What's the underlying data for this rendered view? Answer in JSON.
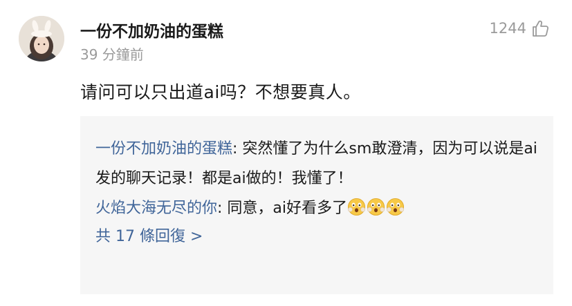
{
  "comment": {
    "username": "一份不加奶油的蛋糕",
    "time": "39 分鐘前",
    "likes": "1244",
    "text": "请问可以只出道ai吗？不想要真人。"
  },
  "replies": [
    {
      "user": "一份不加奶油的蛋糕",
      "separator": ": ",
      "text": "突然懂了为什么sm敢澄清，因为可以说是ai发的聊天记录！都是ai做的！我懂了！"
    },
    {
      "user": "火焰大海无尽的你",
      "separator": ": ",
      "text": "同意，ai好看多了",
      "emojis": [
        "astonished-face",
        "astonished-face",
        "astonished-face"
      ]
    }
  ],
  "more_replies": "共 17 條回復 >",
  "colors": {
    "link_blue": "#406599",
    "muted_gray": "#9a9a9a",
    "reply_bg": "#f6f6f6"
  },
  "icons": {
    "like": "thumbs-up-icon",
    "emoji": "astonished-face-emoji-icon"
  }
}
